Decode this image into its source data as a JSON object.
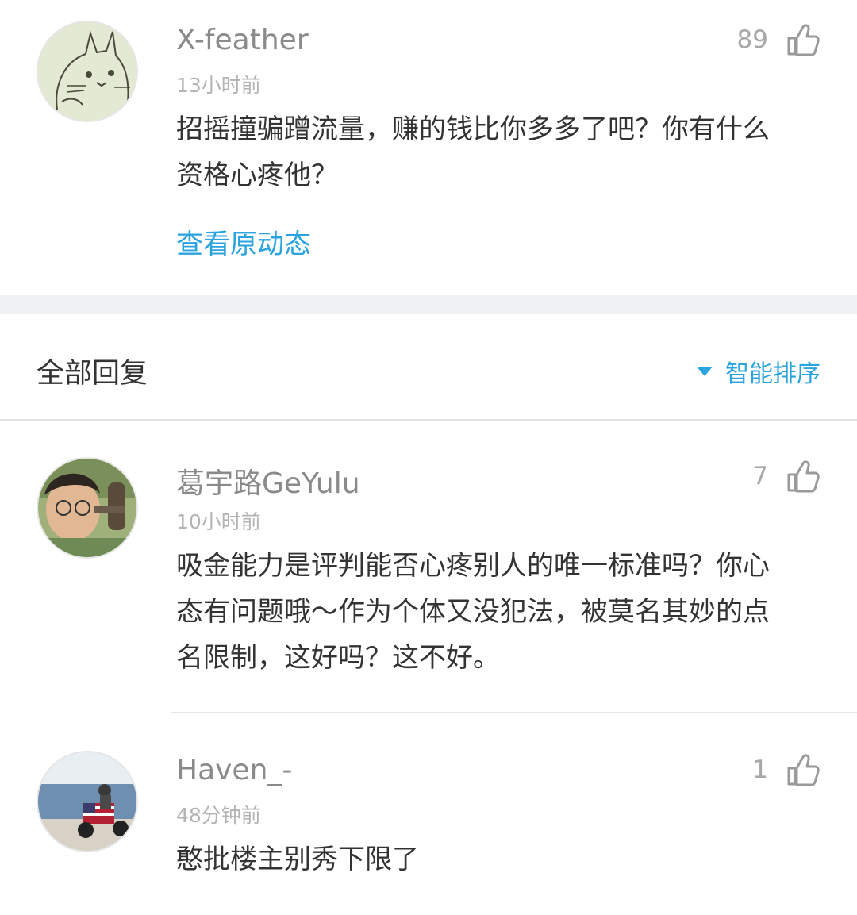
{
  "original_post": {
    "username": "X-feather",
    "time": "13小时前",
    "text_lines": [
      "招摇撞骗蹭流量，赚的钱比你多多了吧？你有什么",
      "资格心疼他？"
    ],
    "likes": "89",
    "view_original_label": "查看原动态"
  },
  "replies_header": {
    "title": "全部回复",
    "sort_label": "智能排序"
  },
  "replies": [
    {
      "username": "葛宇路GeYulu",
      "time": "10小时前",
      "text_lines": [
        "吸金能力是评判能否心疼别人的唯一标准吗？你心",
        "态有问题哦～作为个体又没犯法，被莫名其妙的点",
        "名限制，这好吗？这不好。"
      ],
      "likes": "7"
    },
    {
      "username": "Haven_-",
      "time": "48分钟前",
      "text_lines": [
        "憨批楼主别秀下限了"
      ],
      "likes": "1"
    }
  ],
  "icons": {
    "like": "thumbs-up-icon",
    "sort": "triangle-down-icon"
  },
  "colors": {
    "accent": "#2aa3de",
    "username": "#8a8a8a",
    "text": "#333333",
    "band": "#eef2f5"
  }
}
